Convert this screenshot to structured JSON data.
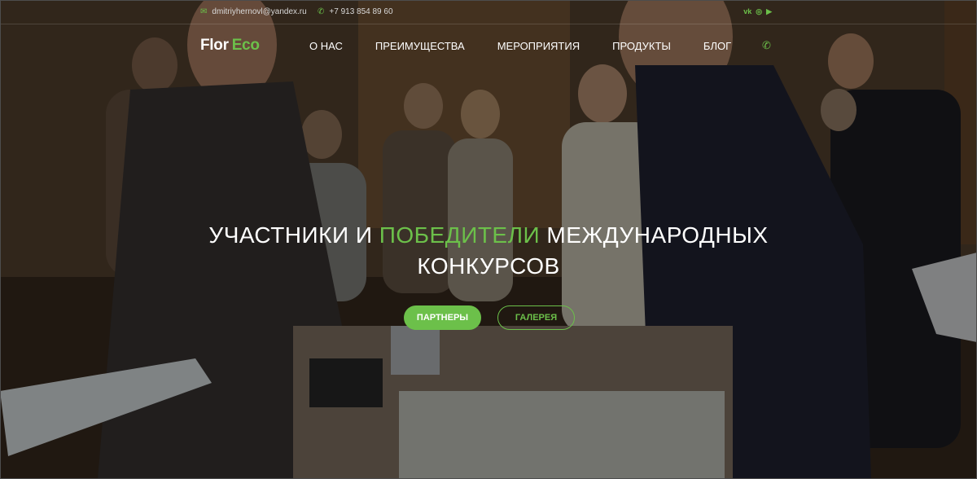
{
  "topbar": {
    "email": "dmitriyhernovl@yandex.ru",
    "phone": "+7 913 854 89 60",
    "email_icon": "envelope-icon",
    "phone_icon": "phone-icon",
    "social": [
      {
        "icon": "vk-icon",
        "glyph": "vk"
      },
      {
        "icon": "instagram-icon",
        "glyph": "◎"
      },
      {
        "icon": "youtube-icon",
        "glyph": "▶"
      }
    ]
  },
  "nav": {
    "logo_part1": "Flor",
    "logo_part2": "Eco",
    "items": [
      "О НАС",
      "ПРЕИМУЩЕСТВА",
      "МЕРОПРИЯТИЯ",
      "ПРОДУКТЫ",
      "БЛОГ"
    ],
    "whatsapp_icon": "whatsapp-icon"
  },
  "hero": {
    "title_part1": "УЧАСТНИКИ И",
    "title_highlight": "ПОБЕДИТЕЛИ",
    "title_part2": "МЕЖДУНАРОДНЫХ",
    "title_line2": "КОНКУРСОВ",
    "button_primary": "ПАРТНЕРЫ",
    "button_secondary": "ГАЛЕРЕЯ"
  },
  "colors": {
    "accent": "#6cc04a",
    "text": "#ffffff",
    "overlay": "rgba(0,0,0,0.45)"
  }
}
